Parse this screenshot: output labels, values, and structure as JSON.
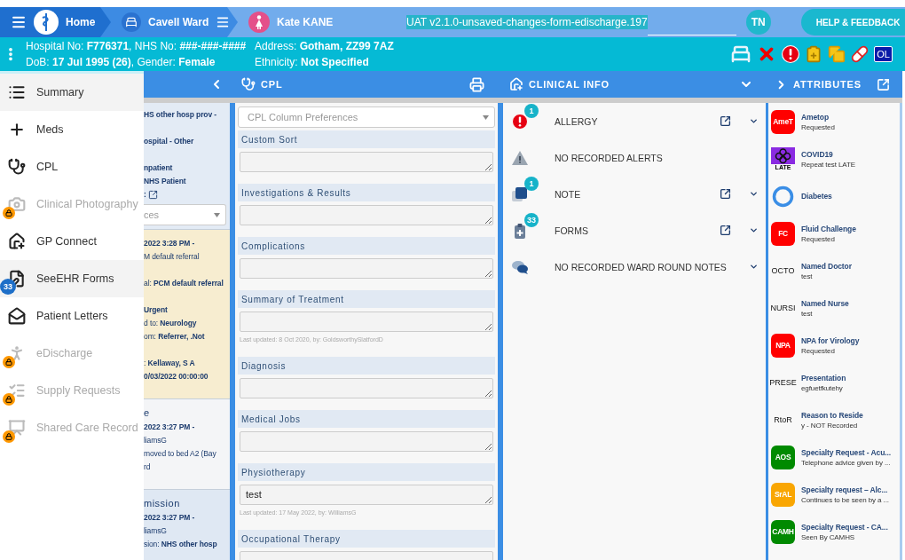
{
  "top_bar": {
    "breadcrumbs": [
      {
        "label": "Home"
      },
      {
        "label": "Cavell Ward"
      },
      {
        "label": "Kate KANE"
      }
    ],
    "build_label": "UAT v2.1.0-unsaved-changes-form-edischarge.197",
    "user_initials": "TN",
    "help_button": "HELP & FEEDBACK"
  },
  "patient_banner": {
    "column_1": [
      "Hospital No: **F776371**, NHS No: **###-###-####**",
      "DoB: **17 Jul 1995 (26)**, Gender: **Female**"
    ],
    "column_2": [
      "Address: **Gotham, ZZ99 7AZ**",
      "Ethnicity: **Not Specified**"
    ],
    "status_badge": "OL"
  },
  "side_menu": {
    "items": [
      {
        "label": "Summary",
        "highlighted": true,
        "disabled": false
      },
      {
        "label": "Meds",
        "highlighted": false,
        "disabled": false
      },
      {
        "label": "CPL",
        "highlighted": false,
        "disabled": false
      },
      {
        "label": "Clinical Photography",
        "highlighted": false,
        "disabled": true
      },
      {
        "label": "GP Connect",
        "highlighted": false,
        "disabled": false
      },
      {
        "label": "SeeEHR Forms",
        "highlighted": true,
        "disabled": false,
        "badge": "33"
      },
      {
        "label": "Patient Letters",
        "highlighted": false,
        "disabled": false
      },
      {
        "label": "eDischarge",
        "highlighted": false,
        "disabled": true
      },
      {
        "label": "Supply Requests",
        "highlighted": false,
        "disabled": true
      },
      {
        "label": "Shared Care Record",
        "highlighted": false,
        "disabled": true
      }
    ]
  },
  "summary_panel": {
    "groups": [
      [
        "HS other hosp prov -"
      ],
      [
        "ospital - Other"
      ],
      [
        "npatient",
        "NHS Patient"
      ]
    ],
    "link_prefix": ":",
    "dropdown": {
      "value": "ces"
    },
    "cards": [
      {
        "kind": "referral",
        "groups": [
          [
            "**2022 3:28 PM -**",
            "M default referral"
          ],
          [
            "al: **PCM default referral**"
          ],
          [
            "**Urgent**",
            "d to: **Neurology**",
            "om: **Referrer, .Not**"
          ],
          [
            ": **Kellaway, S A**",
            "**0/03/2022 00:00:00**"
          ]
        ]
      },
      {
        "kind": "event",
        "heading": "e",
        "groups": [
          [
            "**2022 3:27 PM -**",
            "liamsG",
            "moved to bed A2 (Bay",
            "rd"
          ]
        ]
      },
      {
        "kind": "admission",
        "heading": "mission",
        "groups": [
          [
            "**2022 3:27 PM -**",
            "liamsG",
            "sion: **NHS other hosp**"
          ]
        ]
      }
    ]
  },
  "cpl": {
    "title": "CPL",
    "preferences": {
      "placeholder": "CPL Column Preferences"
    },
    "sections": [
      {
        "label": "Custom Sort"
      },
      {
        "label": "Investigations & Results"
      },
      {
        "label": "Complications"
      },
      {
        "label": "Summary of Treatment",
        "note": "Last updated: 8 Oct 2020, by: GoldsworthySlatfordD"
      },
      {
        "label": "Diagnosis"
      },
      {
        "label": "Medical Jobs"
      },
      {
        "label": "Physiotherapy",
        "value": "test",
        "note": "Last updated: 17 May 2022, by: WilliamsG"
      },
      {
        "label": "Occupational Therapy"
      }
    ]
  },
  "clinical_info": {
    "title": "CLINICAL INFO",
    "rows": [
      {
        "label": "ALLERGY",
        "badge": "1",
        "link": true,
        "expandable": true
      },
      {
        "label": "NO RECORDED ALERTS",
        "link": false,
        "expandable": false
      },
      {
        "label": "NOTE",
        "badge": "1",
        "link": true,
        "expandable": true
      },
      {
        "label": "FORMS",
        "badge": "33",
        "link": true,
        "expandable": true
      },
      {
        "label": "NO RECORDED WARD ROUND NOTES",
        "link": false,
        "expandable": true
      }
    ]
  },
  "attributes": {
    "title": "ATTRIBUTES",
    "items": [
      {
        "kind": "tile",
        "tile_text": "AmeT",
        "color": "#ff0000",
        "name": "Ametop",
        "detail": "Requested"
      },
      {
        "kind": "image",
        "tile_text": "LATE",
        "name": "COVID19",
        "detail": "Repeat test LATE"
      },
      {
        "kind": "ring",
        "name": "Diabetes"
      },
      {
        "kind": "tile",
        "tile_text": "FC",
        "color": "#ff0000",
        "name": "Fluid Challenge",
        "detail": "Requested"
      },
      {
        "kind": "text",
        "tile_text": "OCTO",
        "name": "Named Doctor",
        "detail": "test"
      },
      {
        "kind": "text",
        "tile_text": "NURSI",
        "name": "Named Nurse",
        "detail": "test"
      },
      {
        "kind": "tile",
        "tile_text": "NPA",
        "color": "#ff0000",
        "name": "NPA for Virology",
        "detail": "Requested"
      },
      {
        "kind": "text",
        "tile_text": "PRESE",
        "name": "Presentation",
        "detail": "egfuetfkutehy"
      },
      {
        "kind": "text",
        "tile_text": "RtoR",
        "name": "Reason to Reside",
        "detail": "y - NOT Recorded"
      },
      {
        "kind": "tile",
        "tile_text": "AOS",
        "color": "#008a00",
        "name": "Specialty Request - Acu...",
        "detail": "Telephone advice given by ..."
      },
      {
        "kind": "tile",
        "tile_text": "SrAL",
        "color": "#f9a602",
        "name": "Specialty request – Alc...",
        "detail": "Continues to be seen by a ..."
      },
      {
        "kind": "tile",
        "tile_text": "CAMH",
        "color": "#008a00",
        "name": "Specialty Request - CA...",
        "detail": "Seen By CAMHS"
      }
    ]
  }
}
